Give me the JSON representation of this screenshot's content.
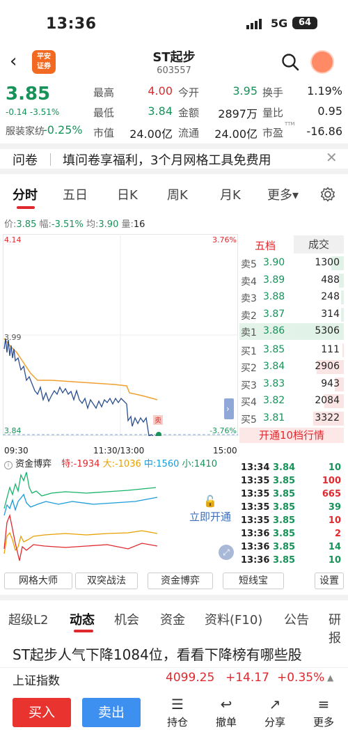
{
  "status_bar": {
    "time": "13:36",
    "network": "5G",
    "battery": "64"
  },
  "header": {
    "logo_text": "平安\n证券",
    "stock_name": "ST起步",
    "stock_code": "603557"
  },
  "quote": {
    "price": "3.85",
    "change": "-0.14 -3.51%",
    "sector_name": "服装家纺",
    "sector_change": "-0.25%",
    "rows": [
      [
        {
          "label": "最高",
          "value": "4.00",
          "color": "red"
        },
        {
          "label": "今开",
          "value": "3.95",
          "color": "green"
        },
        {
          "label": "换手",
          "value": "1.19%",
          "color": "black"
        }
      ],
      [
        {
          "label": "最低",
          "value": "3.84",
          "color": "green"
        },
        {
          "label": "金额",
          "value": "2897万",
          "color": "black"
        },
        {
          "label": "量比",
          "value": "0.95",
          "color": "black"
        }
      ],
      [
        {
          "label": "市值",
          "value": "24.00亿",
          "color": "black"
        },
        {
          "label": "流通",
          "value": "24.00亿",
          "color": "black"
        },
        {
          "label": "市盈",
          "value": "-16.86",
          "color": "black",
          "sup": "TTM"
        }
      ]
    ]
  },
  "banner": {
    "tag": "问卷",
    "text": "填问卷享福利，3个月网格工具免费用"
  },
  "tabs": [
    "分时",
    "五日",
    "日K",
    "周K",
    "月K",
    "更多"
  ],
  "info_line": {
    "price_label": "价:",
    "price": "3.85",
    "amp_label": "幅:",
    "amp": "-3.51%",
    "avg_label": "均:",
    "avg": "3.90",
    "vol_label": "量:",
    "vol": "16"
  },
  "chart_labels": {
    "top_left": "4.14",
    "top_right": "3.76%",
    "mid_left": "3.99",
    "bottom_left": "3.84",
    "bottom_right": "-3.76%",
    "sell_marker": "卖",
    "t_start": "09:30",
    "t_mid": "11:30/13:00",
    "t_end": "15:00"
  },
  "chart_data": {
    "type": "line",
    "ylim": [
      3.84,
      4.14
    ],
    "series": [],
    "x": [
      "09:30",
      "11:30/13:00",
      "15:00"
    ]
  },
  "orderbook": {
    "head_left": "五档",
    "head_right": "成交",
    "asks": [
      {
        "label": "卖5",
        "price": "3.90",
        "vol": "1300",
        "bar": 0.25
      },
      {
        "label": "卖4",
        "price": "3.89",
        "vol": "488",
        "bar": 0.1
      },
      {
        "label": "卖3",
        "price": "3.88",
        "vol": "248",
        "bar": 0.05
      },
      {
        "label": "卖2",
        "price": "3.87",
        "vol": "314",
        "bar": 0.06
      },
      {
        "label": "卖1",
        "price": "3.86",
        "vol": "5306",
        "bar": 1.0
      }
    ],
    "bids": [
      {
        "label": "买1",
        "price": "3.85",
        "vol": "111",
        "bar": 0.03
      },
      {
        "label": "买2",
        "price": "3.84",
        "vol": "2906",
        "bar": 0.55
      },
      {
        "label": "买3",
        "price": "3.83",
        "vol": "943",
        "bar": 0.18
      },
      {
        "label": "买4",
        "price": "3.82",
        "vol": "2084",
        "bar": 0.4
      },
      {
        "label": "买5",
        "price": "3.81",
        "vol": "3322",
        "bar": 0.63
      }
    ],
    "more": "开通10档行情"
  },
  "trades": [
    {
      "time": "13:34",
      "price": "3.84",
      "vol": "10",
      "color": "green"
    },
    {
      "time": "13:35",
      "price": "3.85",
      "vol": "100",
      "color": "red"
    },
    {
      "time": "13:35",
      "price": "3.85",
      "vol": "665",
      "color": "red"
    },
    {
      "time": "13:35",
      "price": "3.85",
      "vol": "39",
      "color": "green"
    },
    {
      "time": "13:35",
      "price": "3.85",
      "vol": "10",
      "color": "red"
    },
    {
      "time": "13:36",
      "price": "3.85",
      "vol": "2",
      "color": "red"
    },
    {
      "time": "13:36",
      "price": "3.85",
      "vol": "14",
      "color": "green"
    },
    {
      "time": "13:36",
      "price": "3.85",
      "vol": "10",
      "color": "green"
    }
  ],
  "fund_flow": {
    "title": "资金博弈",
    "te": "特:-1934",
    "da": "大:-1036",
    "zhong": "中:1560",
    "xiao": "小:1410",
    "open_label": "立即开通"
  },
  "tools": [
    "网格大师",
    "双突战法",
    "资金博弈",
    "短线宝",
    "设置"
  ],
  "bottom_tabs": [
    "超级L2",
    "动态",
    "机会",
    "资金",
    "资料(F10)",
    "公告",
    "研报"
  ],
  "news_title": "ST起步人气下降1084位，看看下降榜有哪些股",
  "index": {
    "name": "上证指数",
    "value": "4099.25",
    "change": "+14.17",
    "pct": "+0.35%"
  },
  "actions": {
    "buy": "买入",
    "sell": "卖出",
    "nav": [
      "持仓",
      "撤单",
      "分享",
      "更多"
    ]
  },
  "colors": {
    "red": "#e0292f",
    "green": "#17935a",
    "blue": "#3d8ff0",
    "orange": "#f26a21"
  }
}
